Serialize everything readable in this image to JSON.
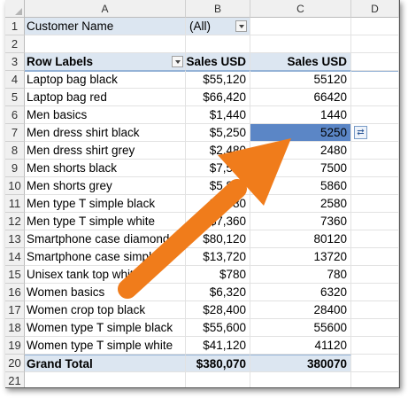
{
  "columns": [
    "A",
    "B",
    "C",
    "D"
  ],
  "row_numbers": [
    "1",
    "2",
    "3",
    "4",
    "5",
    "6",
    "7",
    "8",
    "9",
    "10",
    "11",
    "12",
    "13",
    "14",
    "15",
    "16",
    "17",
    "18",
    "19",
    "20",
    "21"
  ],
  "filter": {
    "label": "Customer Name",
    "value": "(All)"
  },
  "headers": {
    "row_labels": "Row Labels",
    "sales_b": "Sales USD",
    "sales_c": "Sales USD"
  },
  "rows": [
    {
      "label": "Laptop bag black",
      "b": "$55,120",
      "c": "55120"
    },
    {
      "label": "Laptop bag red",
      "b": "$66,420",
      "c": "66420"
    },
    {
      "label": "Men basics",
      "b": "$1,440",
      "c": "1440"
    },
    {
      "label": "Men dress shirt black",
      "b": "$5,250",
      "c": "5250"
    },
    {
      "label": "Men dress shirt grey",
      "b": "$2,480",
      "c": "2480"
    },
    {
      "label": "Men shorts black",
      "b": "$7,500",
      "c": "7500"
    },
    {
      "label": "Men shorts grey",
      "b": "$5,860",
      "c": "5860"
    },
    {
      "label": "Men type T simple black",
      "b": "$2,580",
      "c": "2580"
    },
    {
      "label": "Men type T simple white",
      "b": "$7,360",
      "c": "7360"
    },
    {
      "label": "Smartphone case diamond",
      "b": "$80,120",
      "c": "80120"
    },
    {
      "label": "Smartphone case simple",
      "b": "$13,720",
      "c": "13720"
    },
    {
      "label": "Unisex tank top white",
      "b": "$780",
      "c": "780"
    },
    {
      "label": "Women basics",
      "b": "$6,320",
      "c": "6320"
    },
    {
      "label": "Women crop top black",
      "b": "$28,400",
      "c": "28400"
    },
    {
      "label": "Women type T simple black",
      "b": "$55,600",
      "c": "55600"
    },
    {
      "label": "Women type T simple white",
      "b": "$41,120",
      "c": "41120"
    }
  ],
  "grand_total": {
    "label": "Grand Total",
    "b": "$380,070",
    "c": "380070"
  },
  "selected_cell": "C7",
  "colors": {
    "accent": "#5b86c6",
    "pivot_header": "#dce6f1",
    "arrow": "#f07c1b"
  },
  "icons": {
    "filter_dropdown": "dropdown-arrow-icon",
    "paste_options": "paste-options-icon"
  }
}
